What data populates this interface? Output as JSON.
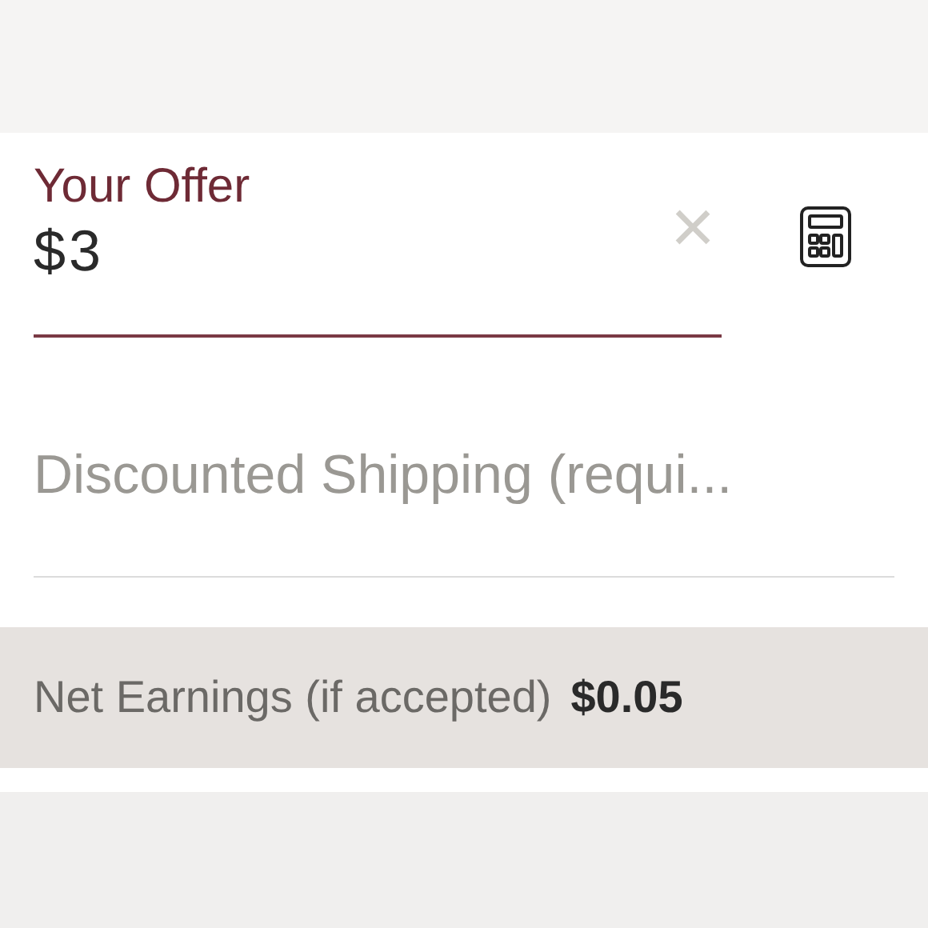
{
  "offer": {
    "label": "Your Offer",
    "value": "$3",
    "clear": "×"
  },
  "shipping": {
    "placeholder": "Discounted Shipping (requi..."
  },
  "net_earnings": {
    "label": "Net Earnings (if accepted)",
    "amount": "$0.05"
  }
}
